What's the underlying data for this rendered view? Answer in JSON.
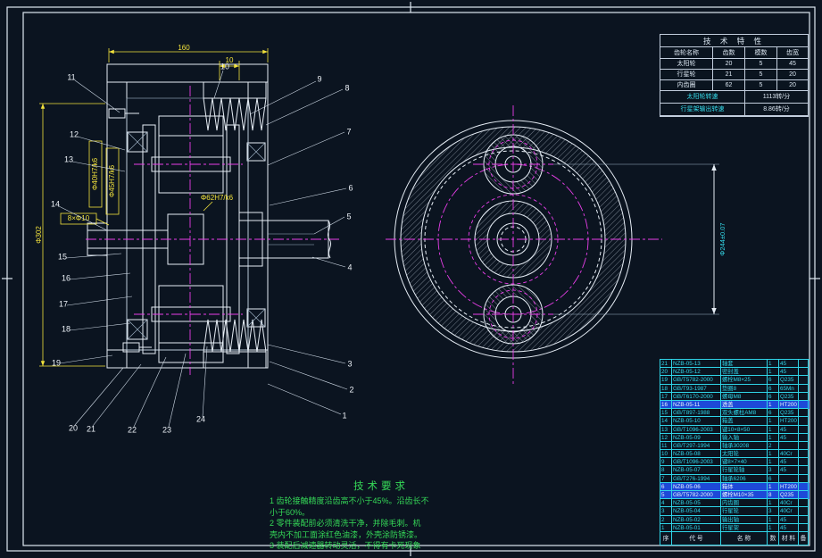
{
  "colors": {
    "background": "#0b1420",
    "line_white": "#e6edf5",
    "dimension_yellow": "#f2e23c",
    "centerline_magenta": "#e83ee8",
    "annotation_green": "#35d957",
    "bom_cyan": "#2fd3e6",
    "selection_blue": "#1d49d8"
  },
  "callouts": [
    "1",
    "2",
    "3",
    "4",
    "5",
    "6",
    "7",
    "8",
    "9",
    "10",
    "11",
    "12",
    "13",
    "14",
    "15",
    "16",
    "17",
    "18",
    "19",
    "20",
    "21",
    "22",
    "23",
    "24"
  ],
  "dimensions": {
    "top_width": "160",
    "fin_width": "10",
    "housing_dia": "Φ302",
    "fit_a": "Φ40H7/k6",
    "fit_b": "Φ45H7/k6",
    "fit_c": "Φ62H7/k6",
    "bolt_holes": "8×Φ10",
    "planet_center_dia": "Φ244±0.07"
  },
  "spec_table": {
    "title": "技 术 特 性",
    "headers": [
      "齿轮名称",
      "齿数",
      "模数",
      "齿宽"
    ],
    "rows": [
      [
        "太阳轮",
        "20",
        "5",
        "45"
      ],
      [
        "行星轮",
        "21",
        "5",
        "20"
      ],
      [
        "内齿圈",
        "62",
        "5",
        "20"
      ]
    ],
    "speed_rows": [
      [
        "太阳轮转速",
        "1113转/分"
      ],
      [
        "行星架输出转速",
        "8.86转/分"
      ]
    ]
  },
  "tech_requirements": {
    "title": "技术要求",
    "lines": [
      "1 齿轮接触精度沿齿高不小于45%。沿齿长不",
      "小于60%。",
      "2 零件装配前必须清洗干净，并除毛刺。机",
      "壳内不加工面涂红色油漆，外壳涂防锈漆。",
      "3 装配后减速器转动灵活，不得有卡死现象"
    ]
  },
  "bom": {
    "headers": [
      "序号",
      "代  号",
      "名  称",
      "数量",
      "材 料",
      "备注"
    ],
    "rows": [
      {
        "c": [
          "21",
          "NZB-05-13",
          "轴套",
          "1",
          "45",
          ""
        ],
        "hl": false
      },
      {
        "c": [
          "20",
          "NZB-05-12",
          "密封盖",
          "1",
          "45",
          ""
        ],
        "hl": false
      },
      {
        "c": [
          "19",
          "GB/T5782-2000",
          "螺栓M8×25",
          "6",
          "Q235",
          ""
        ],
        "hl": false
      },
      {
        "c": [
          "18",
          "GB/T93-1987",
          "垫圈8",
          "6",
          "65Mn",
          ""
        ],
        "hl": false
      },
      {
        "c": [
          "17",
          "GB/T6170-2000",
          "螺母M8",
          "6",
          "Q235",
          ""
        ],
        "hl": false
      },
      {
        "c": [
          "16",
          "NZB-05-11",
          "透盖",
          "1",
          "HT200",
          ""
        ],
        "hl": true
      },
      {
        "c": [
          "15",
          "GB/T897-1988",
          "双头螺柱AM8",
          "6",
          "Q235",
          ""
        ],
        "hl": false
      },
      {
        "c": [
          "14",
          "NZB-05-10",
          "箱盖",
          "1",
          "HT200",
          ""
        ],
        "hl": false
      },
      {
        "c": [
          "13",
          "GB/T1096-2003",
          "键10×8×50",
          "1",
          "45",
          ""
        ],
        "hl": false
      },
      {
        "c": [
          "12",
          "NZB-05-09",
          "输入轴",
          "1",
          "45",
          ""
        ],
        "hl": false
      },
      {
        "c": [
          "11",
          "GB/T297-1994",
          "轴承30208",
          "2",
          "",
          ""
        ],
        "hl": false
      },
      {
        "c": [
          "10",
          "NZB-05-08",
          "太阳轮",
          "1",
          "40Cr",
          ""
        ],
        "hl": false
      },
      {
        "c": [
          "9",
          "GB/T1096-2003",
          "键8×7×40",
          "1",
          "45",
          ""
        ],
        "hl": false
      },
      {
        "c": [
          "8",
          "NZB-05-07",
          "行星轮轴",
          "3",
          "45",
          ""
        ],
        "hl": false
      },
      {
        "c": [
          "7",
          "GB/T276-1994",
          "轴承6206",
          "6",
          "",
          ""
        ],
        "hl": false
      },
      {
        "c": [
          "6",
          "NZB-05-06",
          "箱体",
          "1",
          "HT200",
          ""
        ],
        "hl": true
      },
      {
        "c": [
          "5",
          "GB/T5782-2000",
          "螺栓M10×35",
          "8",
          "Q235",
          ""
        ],
        "hl": true
      },
      {
        "c": [
          "4",
          "NZB-05-05",
          "内齿圈",
          "1",
          "40Cr",
          ""
        ],
        "hl": false
      },
      {
        "c": [
          "3",
          "NZB-05-04",
          "行星轮",
          "3",
          "40Cr",
          ""
        ],
        "hl": false
      },
      {
        "c": [
          "2",
          "NZB-05-02",
          "输出轴",
          "1",
          "45",
          ""
        ],
        "hl": false
      },
      {
        "c": [
          "1",
          "NZB-05-01",
          "行星架",
          "1",
          "45",
          ""
        ],
        "hl": false
      }
    ]
  }
}
